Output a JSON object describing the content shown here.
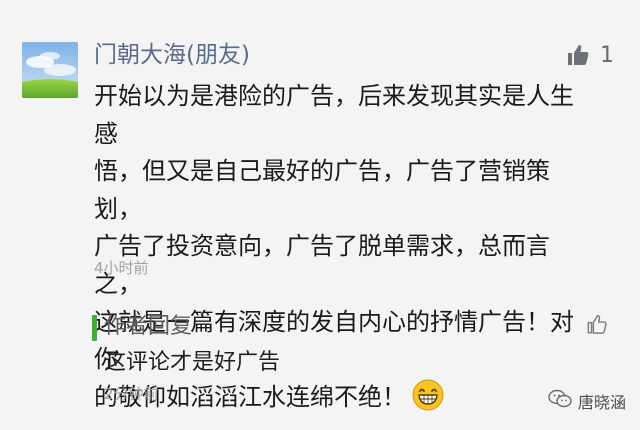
{
  "comment": {
    "author": "门朝大海(朋友)",
    "likes": "1",
    "text": "开始以为是港险的广告，后来发现其实是人生感\n悟，但又是自己最好的广告，广告了营销策划，\n广告了投资意向，广告了脱单需求，总而言之，\n这就是一篇有深度的发自内心的抒情广告！对你\n的敬仰如滔滔江水连绵不绝！",
    "emoji_icon": "grinning-face-icon",
    "time": "4小时前"
  },
  "reply": {
    "title": "作者回复",
    "text": "这评论才是好广告",
    "time": "2分钟前",
    "accent": "#3cb034"
  },
  "watermark": {
    "text": "唐晓涵",
    "icon": "wechat-official-icon"
  }
}
